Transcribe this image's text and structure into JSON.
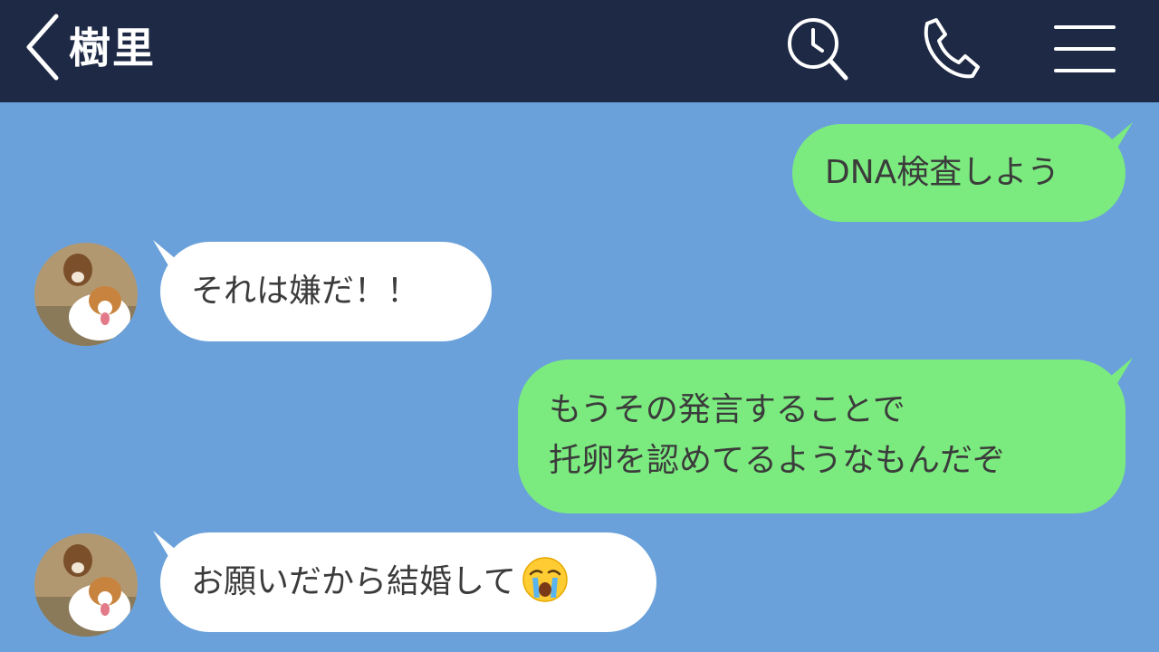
{
  "header": {
    "contact_name": "樹里",
    "back_icon": "chevron-left-icon",
    "search_icon": "search-clock-icon",
    "call_icon": "phone-icon",
    "menu_icon": "hamburger-menu-icon"
  },
  "colors": {
    "header_bg": "#1e2a45",
    "chat_bg": "#6aa1da",
    "outgoing_bubble": "#7beb7f",
    "incoming_bubble": "#ffffff",
    "text": "#3b3b3b"
  },
  "messages": [
    {
      "direction": "outgoing",
      "text": "DNA検査しよう"
    },
    {
      "direction": "incoming",
      "text": "それは嫌だ！！",
      "avatar": "dog-avatar"
    },
    {
      "direction": "outgoing",
      "lines": [
        "もうその発言することで",
        "托卵を認めてるようなもんだぞ"
      ]
    },
    {
      "direction": "incoming",
      "text": "お願いだから結婚して",
      "emoji": "crying-face-emoji",
      "avatar": "dog-avatar"
    }
  ]
}
